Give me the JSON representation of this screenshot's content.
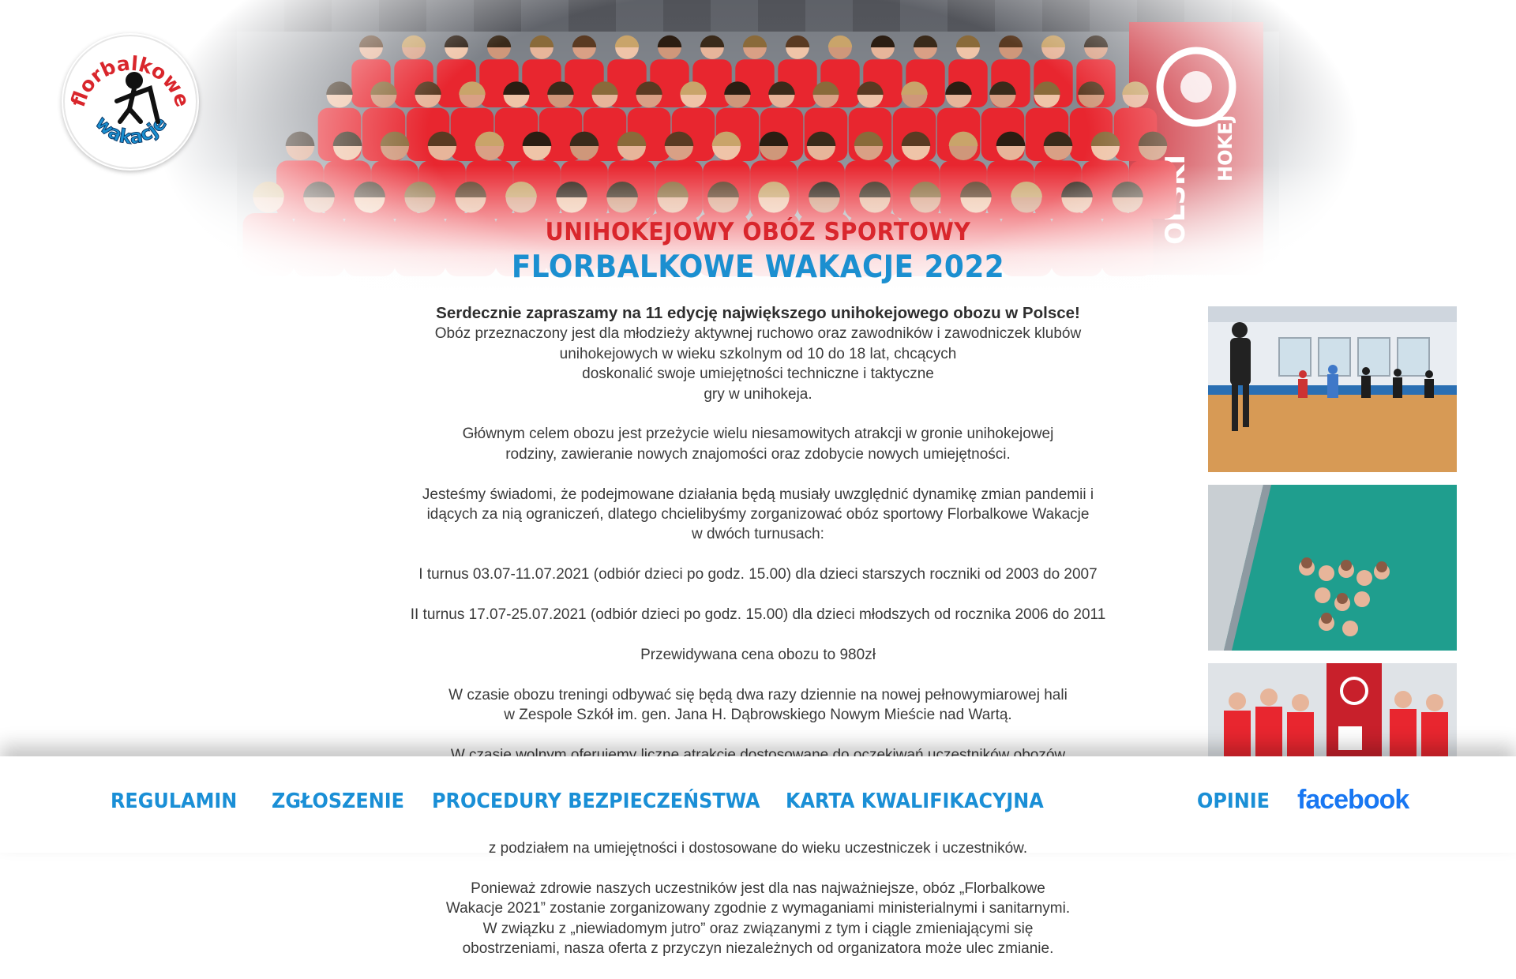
{
  "hero": {
    "title_line1": "UNIHOKEJOWY OBÓZ SPORTOWY",
    "title_line2": "FLORBALKOWE WAKACJE 2022",
    "logo": {
      "text_top": "florbalkowe",
      "text_bottom": "wakacje",
      "icon": "floorball-player-icon"
    },
    "banner_text": "POLSKI ... HOKEJ"
  },
  "content": {
    "lead": "Serdecznie zapraszamy na 11 edycję największego unihokejowego obozu w Polsce!",
    "intro_lines": [
      "Obóz przeznaczony jest dla młodzieży aktywnej ruchowo oraz zawodników i zawodniczek klubów",
      "unihokejowych w wieku szkolnym od 10 do 18 lat, chcących",
      "doskonalić swoje umiejętności techniczne i taktyczne",
      "gry w unihokeja."
    ],
    "goal_lines": [
      "Głównym celem obozu jest przeżycie wielu niesamowitych atrakcji w gronie unihokejowej",
      "rodziny, zawieranie nowych znajomości oraz zdobycie nowych umiejętności."
    ],
    "pandemic_lines": [
      "Jesteśmy świadomi, że podejmowane działania będą musiały uwzględnić dynamikę zmian pandemii i",
      "idących za nią ograniczeń, dlatego chcielibyśmy zorganizować obóz sportowy Florbalkowe Wakacje",
      "w dwóch turnusach:"
    ],
    "turn1": "I turnus 03.07-11.07.2021 (odbiór dzieci po godz. 15.00) dla dzieci starszych roczniki od 2003 do 2007",
    "turn2": "II turnus 17.07-25.07.2021 (odbiór dzieci po godz. 15.00) dla dzieci młodszych od rocznika 2006 do 2011",
    "price": "Przewidywana cena obozu to 980zł",
    "training_lines": [
      "W czasie obozu treningi odbywać się będą dwa razy dziennie na nowej pełnowymiarowej hali",
      "w Zespole Szkół im. gen. Jana H. Dąbrowskiego Nowym Mieście nad Wartą."
    ],
    "free_time_partial": "W czasie wolnym oferujemy liczne atrakcje dostosowane do oczekiwań uczestników obozów",
    "split_partial": "z podziałem na umiejętności i dostosowane do wieku uczestniczek i uczestników.",
    "health_lines": [
      "Ponieważ zdrowie naszych uczestników jest dla nas najważniejsze, obóz „Florbalkowe",
      "Wakacje 2021” zostanie zorganizowany zgodnie z wymaganiami ministerialnymi i sanitarnymi.",
      "W związku z „niewiadomym jutro” oraz związanymi z tym i ciągle zmieniającymi się",
      "obostrzeniami, nasza oferta z przyczyn niezależnych od organizatora może ulec zmianie."
    ]
  },
  "nav": {
    "regulamin": "REGULAMIN",
    "zgloszenie": "ZGŁOSZENIE",
    "procedury": "PROCEDURY BEZPIECZEŃSTWA",
    "karta": "KARTA KWALIFIKACYJNA",
    "opinie": "OPINIE",
    "facebook": "facebook"
  },
  "colors": {
    "title_red": "#d9262c",
    "title_blue": "#1b8fd0",
    "nav_blue": "#1a8fd6",
    "facebook_blue": "#1877f2",
    "shirt_red": "#e8262f"
  }
}
